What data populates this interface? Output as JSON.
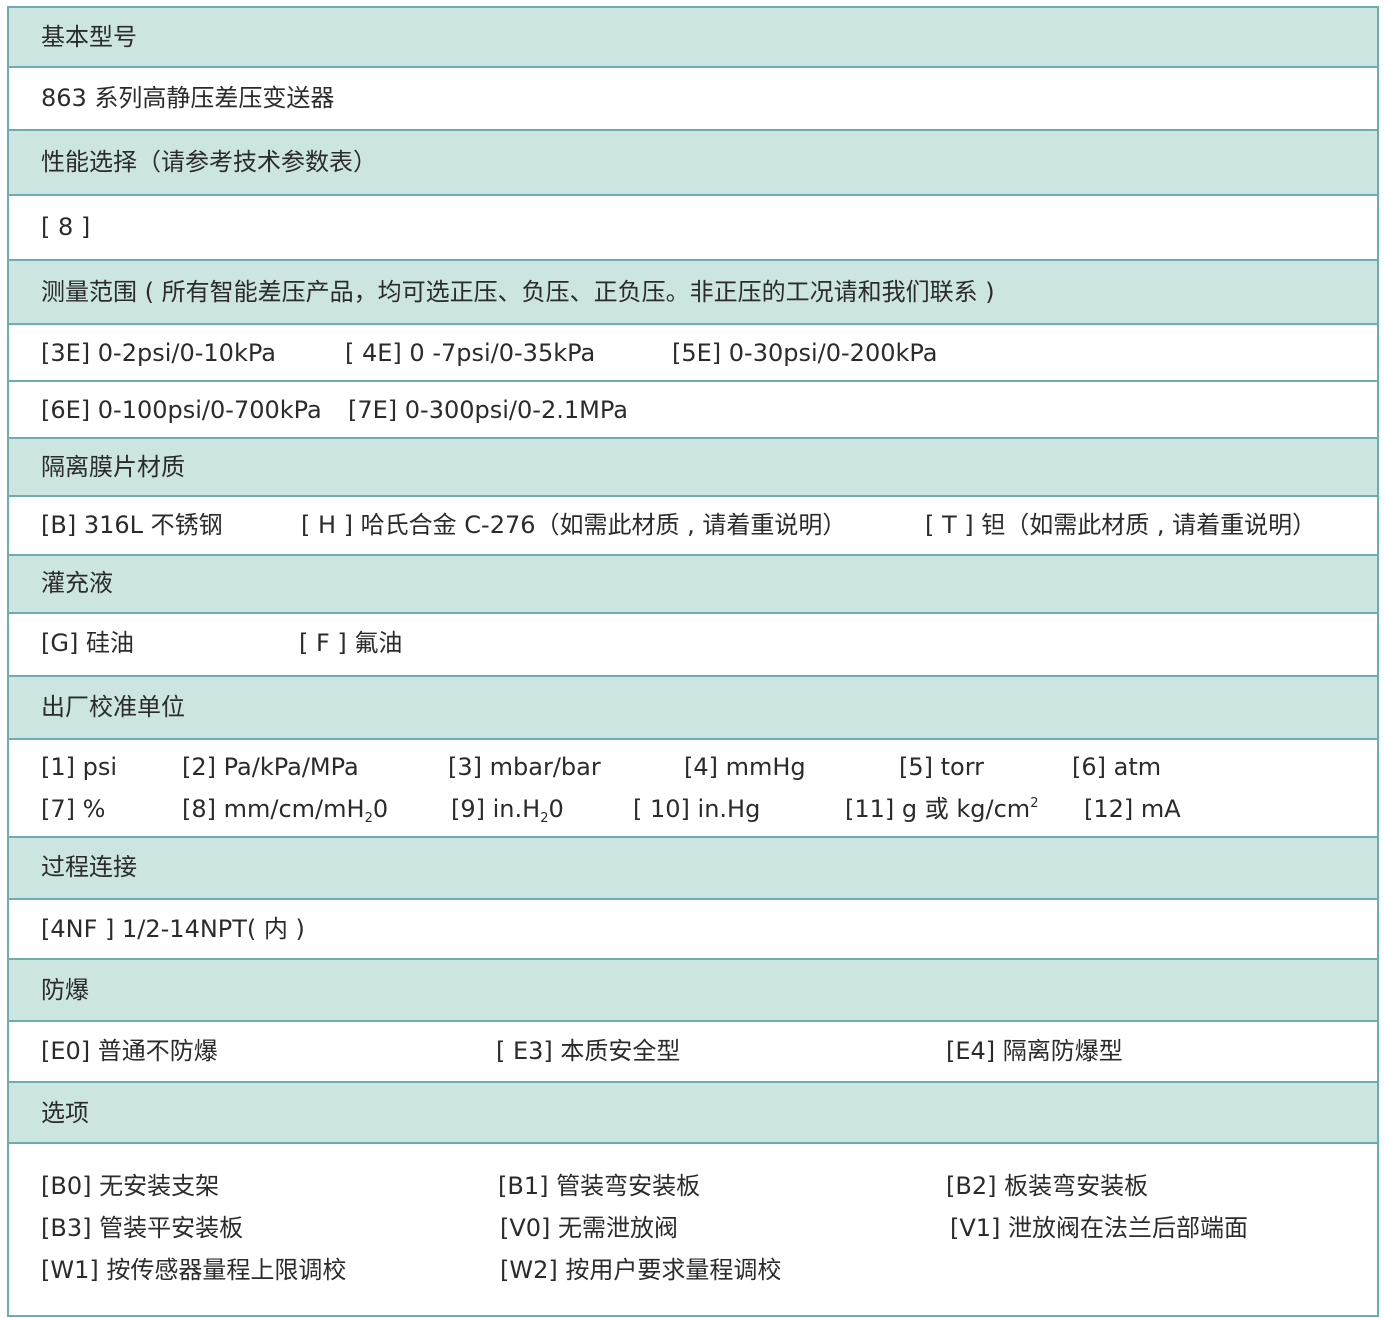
{
  "sections": {
    "model": {
      "title": "基本型号",
      "value": "863 系列高静压差压变送器"
    },
    "performance": {
      "title": "性能选择（请参考技术参数表）",
      "value": "[ 8 ]"
    },
    "range": {
      "title": "测量范围 ( 所有智能差压产品，均可选正压、负压、正负压。非正压的工况请和我们联系 )",
      "options": [
        "[3E] 0-2psi/0-10kPa",
        "[ 4E] 0 -7psi/0-35kPa",
        "[5E] 0-30psi/0-200kPa",
        "[6E] 0-100psi/0-700kPa",
        "[7E] 0-300psi/0-2.1MPa"
      ]
    },
    "diaphragm": {
      "title": "隔离膜片材质",
      "options": [
        "[B] 316L 不锈钢",
        "[ H ] 哈氏合金 C-276（如需此材质 , 请着重说明）",
        "[ T ] 钽（如需此材质 , 请着重说明）"
      ]
    },
    "fill": {
      "title": "灌充液",
      "options": [
        "[G] 硅油",
        "[ F ] 氟油"
      ]
    },
    "units": {
      "title": "出厂校准单位",
      "options": [
        "[1] psi",
        "[2] Pa/kPa/MPa",
        "[3] mbar/bar",
        "[4] mmHg",
        "[5] torr",
        "[6] atm",
        "[7] %"
      ],
      "opt8": {
        "a": "[8] mm/cm/mH",
        "sub": "2",
        "b": "0"
      },
      "opt9": {
        "a": "[9] in.H",
        "sub": "2",
        "b": "0"
      },
      "opt10": "[ 10] in.Hg",
      "opt11": {
        "a": "[11] g 或 kg/cm",
        "sup": "2"
      },
      "opt12": "[12] mA"
    },
    "connection": {
      "title": "过程连接",
      "value": "[4NF ] 1/2-14NPT( 内 )"
    },
    "explosion": {
      "title": "防爆",
      "options": [
        "[E0] 普通不防爆",
        "[ E3] 本质安全型",
        "[E4] 隔离防爆型"
      ]
    },
    "extras": {
      "title": "选项",
      "options": [
        "[B0] 无安装支架",
        "[B1] 管装弯安装板",
        "[B2] 板装弯安装板",
        "[B3] 管装平安装板",
        "[V0] 无需泄放阀",
        "[V1] 泄放阀在法兰后部端面",
        "[W1] 按传感器量程上限调校",
        "[W2] 按用户要求量程调校"
      ]
    }
  }
}
